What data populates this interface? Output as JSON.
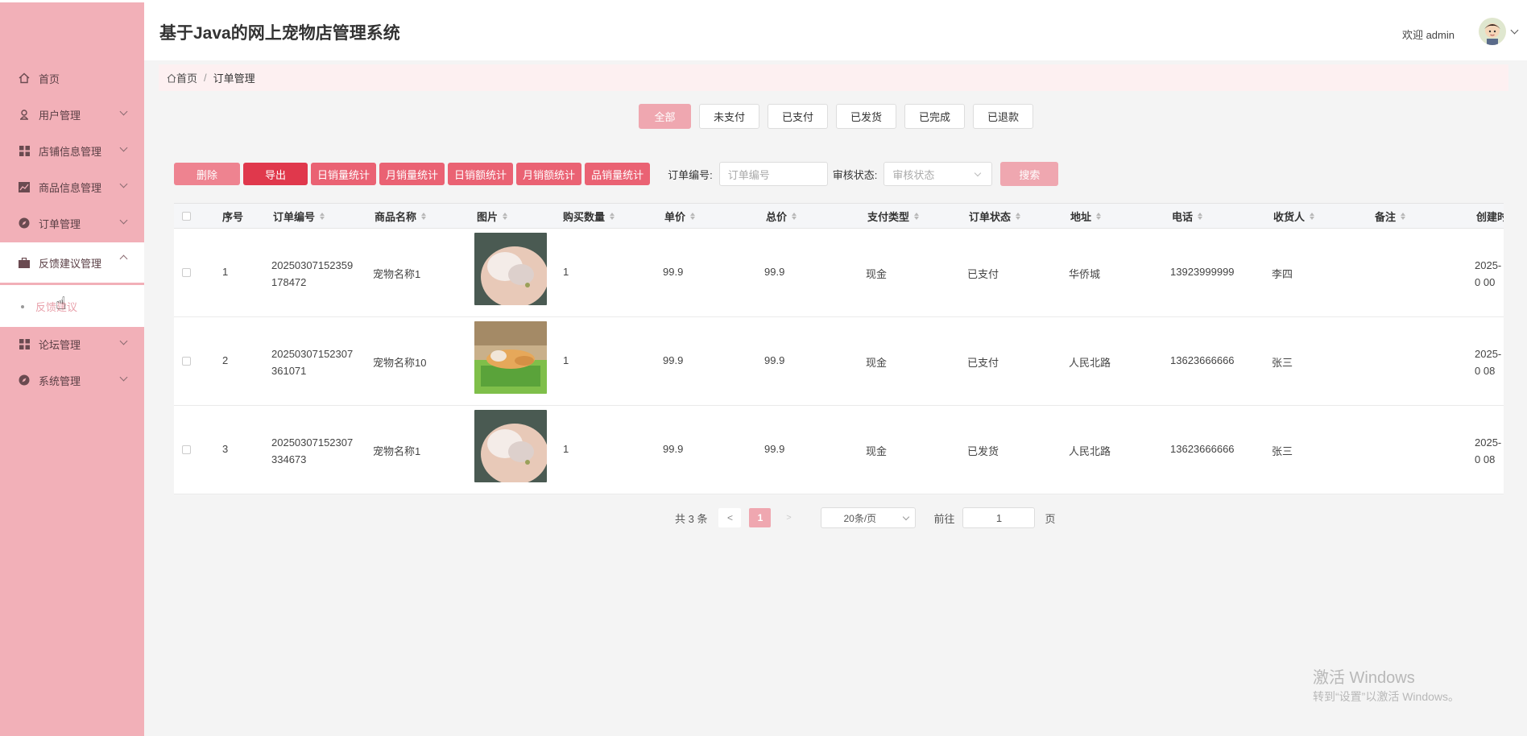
{
  "app": {
    "title": "基于Java的网上宠物店管理系统",
    "welcome": "欢迎 admin"
  },
  "sidebar": {
    "items": [
      {
        "label": "首页",
        "icon": "home-icon"
      },
      {
        "label": "用户管理",
        "icon": "user-icon"
      },
      {
        "label": "店铺信息管理",
        "icon": "grid-icon"
      },
      {
        "label": "商品信息管理",
        "icon": "chart-icon"
      },
      {
        "label": "订单管理",
        "icon": "compass-icon"
      },
      {
        "label": "反馈建议管理",
        "icon": "briefcase-icon"
      },
      {
        "label": "论坛管理",
        "icon": "grid-icon"
      },
      {
        "label": "系统管理",
        "icon": "compass-icon"
      }
    ],
    "sub_item": "反馈建议"
  },
  "breadcrumb": {
    "home": "首页",
    "current": "订单管理"
  },
  "tabs": [
    "全部",
    "未支付",
    "已支付",
    "已发货",
    "已完成",
    "已退款"
  ],
  "toolbar": {
    "delete": "删除",
    "export": "导出",
    "stats": [
      "日销量统计",
      "月销量统计",
      "日销额统计",
      "月销额统计",
      "品销量统计"
    ],
    "order_no_label": "订单编号:",
    "order_no_placeholder": "订单编号",
    "audit_label": "审核状态:",
    "audit_placeholder": "审核状态",
    "search": "搜索"
  },
  "table": {
    "headers": [
      "序号",
      "订单编号",
      "商品名称",
      "图片",
      "购买数量",
      "单价",
      "总价",
      "支付类型",
      "订单状态",
      "地址",
      "电话",
      "收货人",
      "备注",
      "创建时"
    ],
    "rows": [
      {
        "idx": "1",
        "order_no": "20250307152359178472",
        "name": "宠物名称1",
        "qty": "1",
        "price": "99.9",
        "total": "99.9",
        "pay": "现金",
        "status": "已支付",
        "addr": "华侨城",
        "phone": "13923999999",
        "receiver": "李四",
        "remark": "",
        "created": "2025-0 00",
        "img": "hamster"
      },
      {
        "idx": "2",
        "order_no": "20250307152307361071",
        "name": "宠物名称10",
        "qty": "1",
        "price": "99.9",
        "total": "99.9",
        "pay": "现金",
        "status": "已支付",
        "addr": "人民北路",
        "phone": "13623666666",
        "receiver": "张三",
        "remark": "",
        "created": "2025-0 08",
        "img": "dog"
      },
      {
        "idx": "3",
        "order_no": "20250307152307334673",
        "name": "宠物名称1",
        "qty": "1",
        "price": "99.9",
        "total": "99.9",
        "pay": "现金",
        "status": "已发货",
        "addr": "人民北路",
        "phone": "13623666666",
        "receiver": "张三",
        "remark": "",
        "created": "2025-0 08",
        "img": "hamster"
      }
    ]
  },
  "pager": {
    "total": "共 3 条",
    "prev": "<",
    "current": "1",
    "next": ">",
    "size": "20条/页",
    "goto": "前往",
    "goto_value": "1",
    "page_suffix": "页"
  },
  "watermark": {
    "line1": "激活 Windows",
    "line2": "转到“设置”以激活 Windows。"
  },
  "colors": {
    "sidebar": "#f2b0b8",
    "accent": "#efa7b0",
    "danger": "#e0384c",
    "stat_btn": "#ea6273"
  }
}
